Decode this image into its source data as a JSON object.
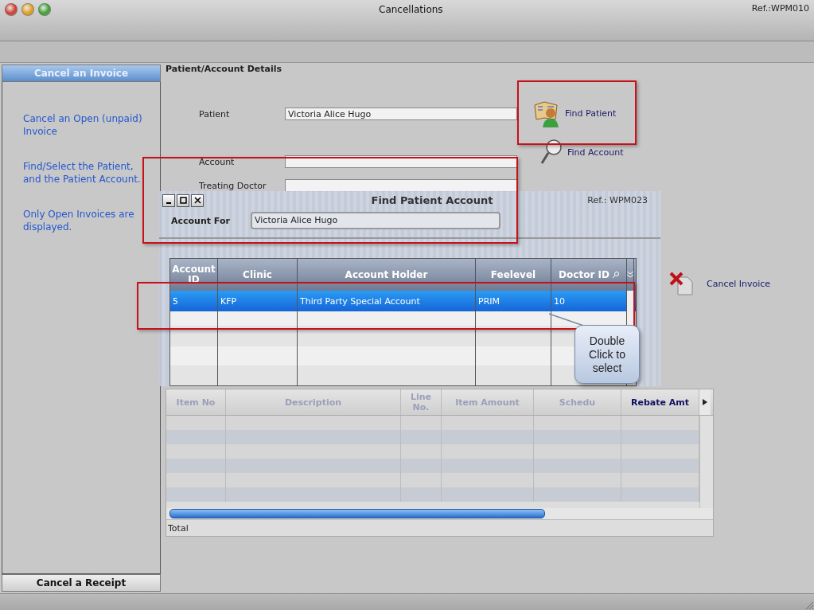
{
  "window": {
    "title": "Cancellations",
    "ref": "Ref.:WPM010"
  },
  "sidebar": {
    "sections": [
      {
        "label": "Cancel an Invoice",
        "selected": true
      },
      {
        "label": "Cancel a Receipt",
        "selected": false
      }
    ],
    "help_texts": [
      "Cancel an Open (unpaid) Invoice",
      "Find/Select the Patient, and the Patient Account.",
      "Only Open Invoices are displayed."
    ]
  },
  "details": {
    "heading": "Patient/Account Details",
    "fields": [
      {
        "label": "Patient",
        "value": "Victoria Alice Hugo"
      },
      {
        "label": "Account"
      },
      {
        "label": "Treating Doctor"
      }
    ]
  },
  "actions": [
    {
      "kind": "patient",
      "label": "Find Patient"
    },
    {
      "kind": "search",
      "label": "Find Account"
    },
    {
      "kind": "cancel",
      "label": "Cancel Invoice"
    }
  ],
  "item_table": {
    "columns": [
      "Item No",
      "Description",
      "Line No.",
      "Item Amount",
      "Schedu",
      "Rebate Amt"
    ],
    "total_label": "Total"
  },
  "dialog": {
    "title": "Find Patient Account",
    "ref": "Ref.: WPM023",
    "account_for": {
      "label": "Account For",
      "value": "Victoria Alice Hugo"
    },
    "table": {
      "columns": [
        "Account ID",
        "Clinic",
        "Account Holder",
        "Feelevel",
        "Doctor ID"
      ],
      "rows": [
        {
          "cells": [
            "5",
            "KFP",
            "Third Party Special Account",
            "PRIM",
            "10"
          ],
          "selected": true
        }
      ]
    }
  },
  "callout": {
    "text": "Double Click to select"
  }
}
